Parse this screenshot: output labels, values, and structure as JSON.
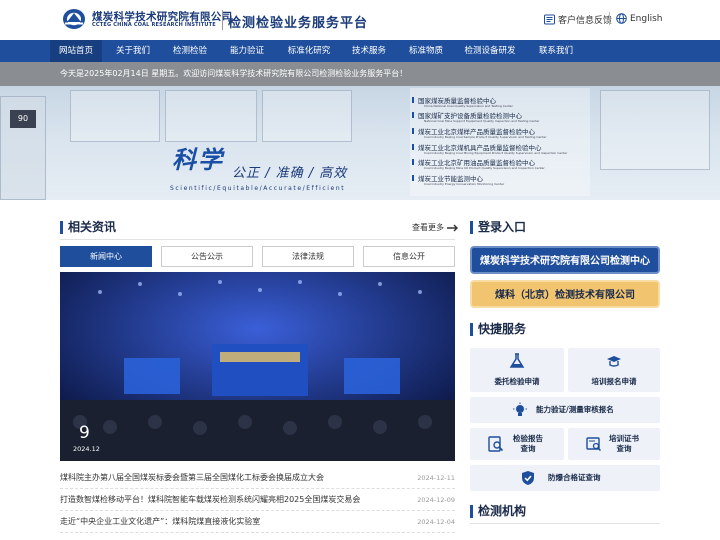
{
  "header": {
    "org_cn": "煤炭科学技术研究院有限公司",
    "org_en": "CCTEG CHINA COAL RESEARCH INSTITUTE",
    "platform_title": "检测检验业务服务平台",
    "feedback_label": "客户信息反馈",
    "language_label": "English",
    "brand_color": "#1e4e9c"
  },
  "nav": {
    "items": [
      "网站首页",
      "关于我们",
      "检测检验",
      "能力验证",
      "标准化研究",
      "技术服务",
      "标准物质",
      "检测设备研发",
      "联系我们"
    ],
    "active_index": 0
  },
  "notice": {
    "text": "今天是2025年02月14日  星期五。欢迎访问煤炭科学技术研究院有限公司检测检验业务服务平台！"
  },
  "banner": {
    "headline": "科学",
    "slogan": "公正 / 准确 / 高效",
    "slogan_en": "Scientific/Equitable/Accurate/Efficient",
    "centers": [
      {
        "name": "国家煤炭质量监督检验中心",
        "sub": "China National Coal Quality Supervision and Testing Center"
      },
      {
        "name": "国家煤矿支护设备质量检验检测中心",
        "sub": "National Coal Mine Support Equipment Quality Inspection and Testing Center"
      },
      {
        "name": "煤炭工业北京煤样产品质量监督检验中心",
        "sub": "Coal Industry Beijing Coal Sample Product Quality Supervision and Testing Center"
      },
      {
        "name": "煤炭工业北京煤机具产品质量监督检验中心",
        "sub": "Coal Industry Beijing Coal Mining Equipment Product Quality Supervision and Inspection Center"
      },
      {
        "name": "煤炭工业北京矿用油品质量监督检验中心",
        "sub": "Coal Industry Beijing Mine Oil Product Quality Supervision and Inspection Center"
      },
      {
        "name": "煤炭工业节能监测中心",
        "sub": "Coal Industry Energy Conservation Monitoring Center"
      }
    ]
  },
  "news": {
    "title": "相关资讯",
    "more_label": "查看更多",
    "tabs": [
      "新闻中心",
      "公告公示",
      "法律法规",
      "信息公开"
    ],
    "active_tab": 0,
    "feature": {
      "day": "9",
      "month": "2024.12"
    },
    "items": [
      {
        "title": "煤科院主办第八届全国煤炭标委会暨第三届全国煤化工标委会换届成立大会",
        "date": "2024-12-11"
      },
      {
        "title": "打造数智煤检移动平台！煤科院智能车载煤炭检测系统闪耀亮相2025全国煤炭交易会",
        "date": "2024-12-09"
      },
      {
        "title": "走近“中央企业工业文化遗产”：煤科院煤直接液化实验室",
        "date": "2024-12-04"
      }
    ]
  },
  "login": {
    "title": "登录入口",
    "buttons": [
      "煤炭科学技术研究院有限公司检测中心",
      "煤科（北京）检测技术有限公司"
    ]
  },
  "services": {
    "title": "快捷服务",
    "items": [
      {
        "label": "委托检验申请",
        "icon": "flask-icon"
      },
      {
        "label": "培训报名申请",
        "icon": "graduation-cap-icon"
      },
      {
        "label": "能力验证/测量审核报名",
        "icon": "lightbulb-icon"
      },
      {
        "label": "检验报告\n查询",
        "icon": "report-search-icon"
      },
      {
        "label": "培训证书\n查询",
        "icon": "certificate-search-icon"
      },
      {
        "label": "防爆合格证查询",
        "icon": "shield-check-icon"
      }
    ]
  },
  "institutions": {
    "title": "检测机构"
  }
}
